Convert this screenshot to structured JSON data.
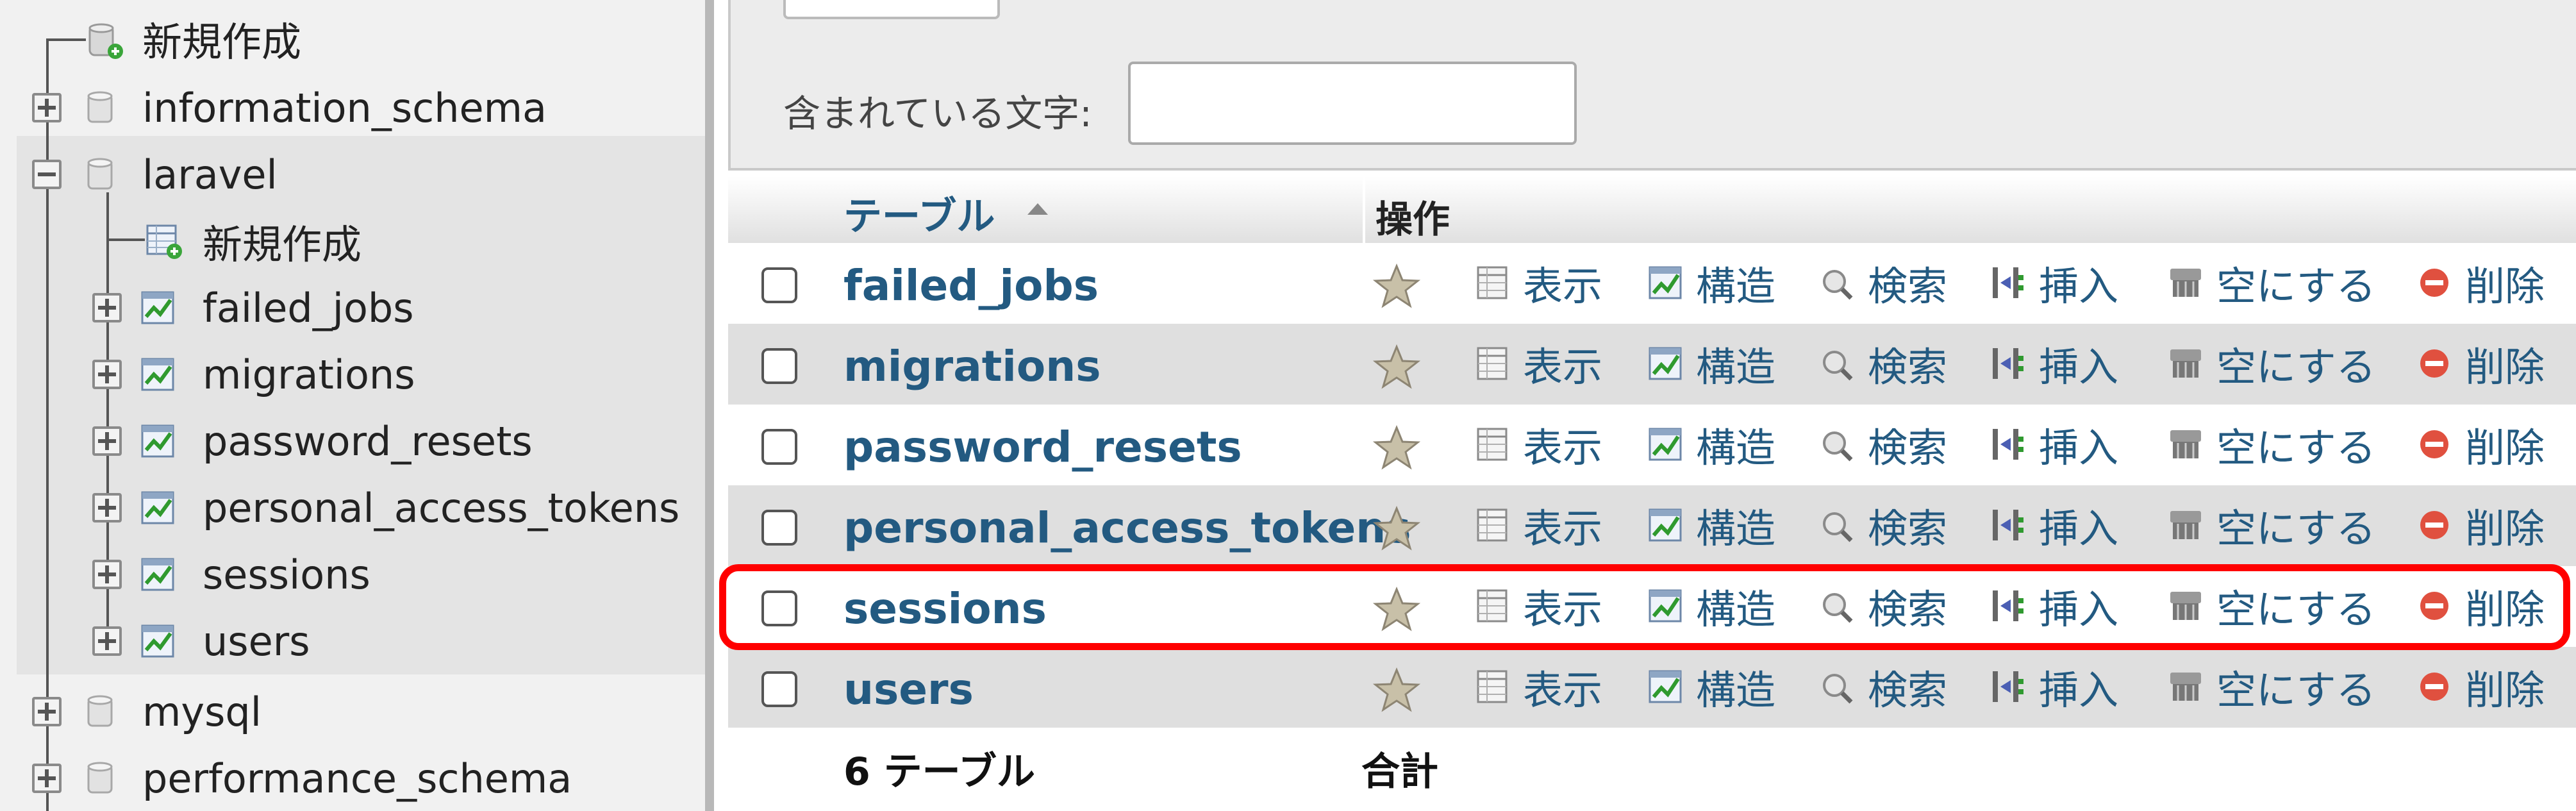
{
  "nav": {
    "new_label": "新規作成",
    "databases": [
      {
        "name": "information_schema",
        "expanded": false
      },
      {
        "name": "laravel",
        "expanded": true
      },
      {
        "name": "mysql",
        "expanded": false
      },
      {
        "name": "performance_schema",
        "expanded": false
      }
    ],
    "laravel_new_label": "新規作成",
    "laravel_tables": [
      "failed_jobs",
      "migrations",
      "password_resets",
      "personal_access_tokens",
      "sessions",
      "users"
    ]
  },
  "filter": {
    "label": "含まれている文字:",
    "value": ""
  },
  "table": {
    "header_table": "テーブル",
    "header_actions": "操作",
    "sort_direction": "ascending",
    "action_labels": {
      "browse": "表示",
      "structure": "構造",
      "search": "検索",
      "insert": "挿入",
      "empty": "空にする",
      "drop": "削除"
    },
    "rows": [
      {
        "name": "failed_jobs"
      },
      {
        "name": "migrations"
      },
      {
        "name": "password_resets"
      },
      {
        "name": "personal_access_tokens"
      },
      {
        "name": "sessions"
      },
      {
        "name": "users"
      }
    ],
    "footer_count": "6 テーブル",
    "footer_total": "合計"
  },
  "colors": {
    "link": "#235a81",
    "highlight": "#ff0000",
    "row_alt": "#dfdfdf"
  }
}
